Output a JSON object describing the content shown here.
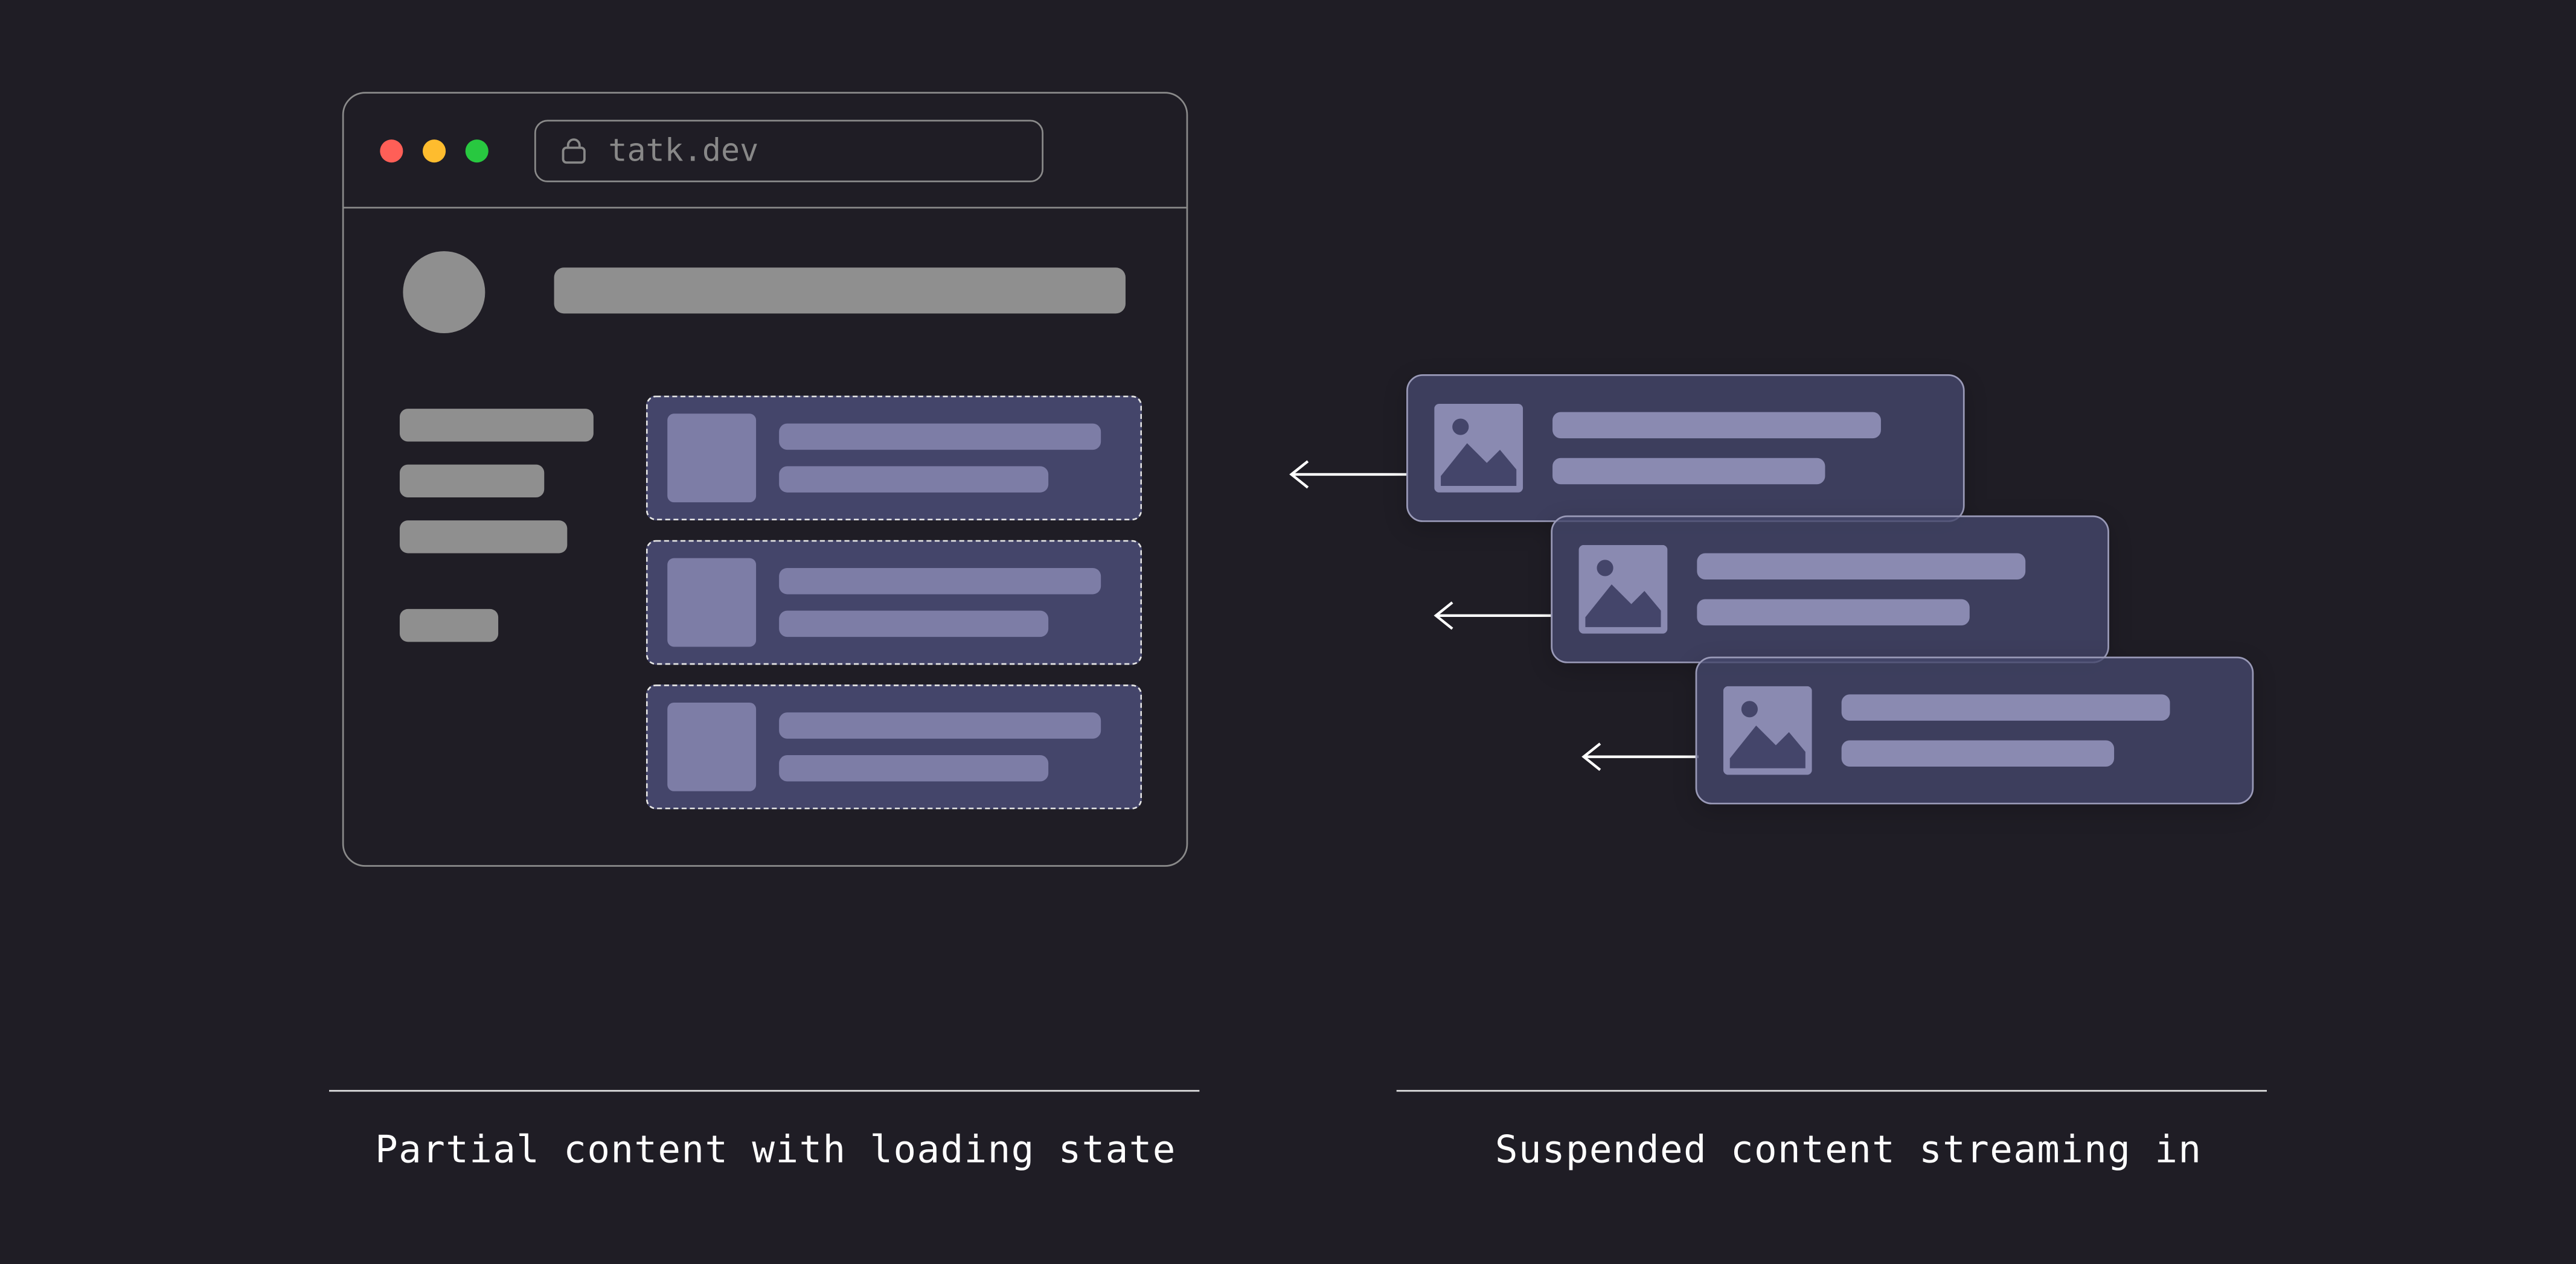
{
  "browser": {
    "url": "tatk.dev",
    "traffic_lights": {
      "close": "#ff5f57",
      "minimize": "#febc2e",
      "zoom": "#28c840"
    }
  },
  "captions": {
    "left": "Partial content with loading state",
    "right": "Suspended content streaming in"
  },
  "icons": {
    "lock": "lock-icon",
    "arrow": "arrow-left-icon",
    "image": "image-icon"
  },
  "colors": {
    "bg": "#1f1d25",
    "placeholder_gray": "#8f8f8f",
    "card_fill": "#44456a",
    "card_fill_light": "#7d7da6",
    "stream_card_fill": "rgba(69,71,108,0.8)",
    "stream_card_border": "#9a9ab8",
    "stream_line": "#8a8ab1"
  },
  "layout": {
    "sidebar_item_widths": [
      118,
      88,
      102,
      60
    ],
    "skeleton_card_count": 3,
    "streaming_card_count": 3
  }
}
